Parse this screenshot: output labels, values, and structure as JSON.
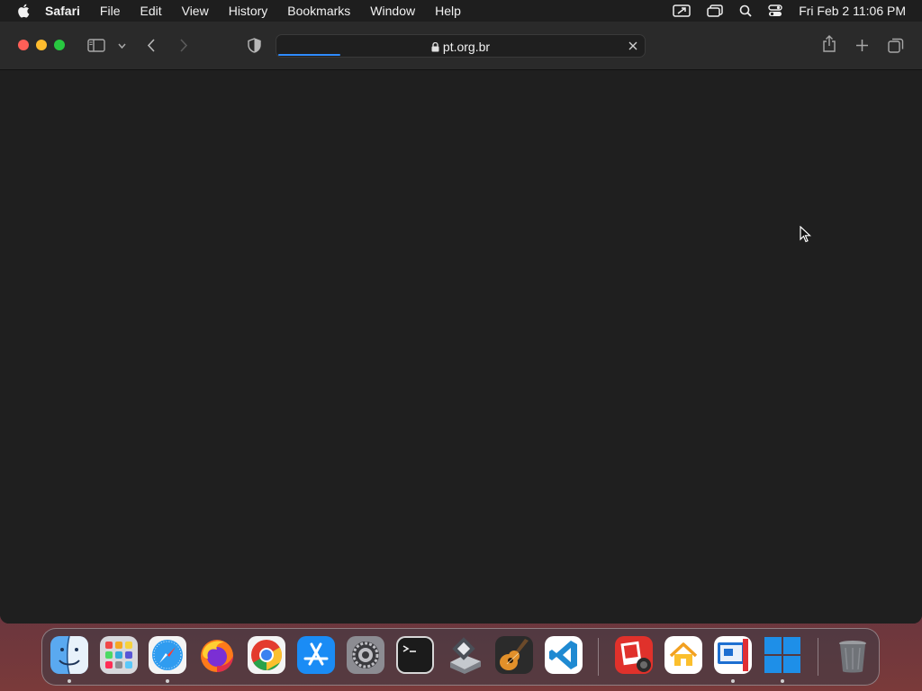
{
  "menubar": {
    "app_name": "Safari",
    "menus": [
      "File",
      "Edit",
      "View",
      "History",
      "Bookmarks",
      "Window",
      "Help"
    ],
    "clock": "Fri Feb 2  11:06 PM"
  },
  "browser": {
    "address": "pt.org.br",
    "load_progress": 0.17
  },
  "dock": {
    "apps": [
      "finder",
      "launchpad",
      "safari",
      "firefox",
      "chrome",
      "app-store",
      "system-settings",
      "terminal",
      "bootcamp-assistant",
      "garageband",
      "vscode",
      "photo-booth",
      "home",
      "remote-desktop",
      "windows"
    ],
    "running": [
      "finder",
      "safari",
      "remote-desktop",
      "windows"
    ]
  }
}
